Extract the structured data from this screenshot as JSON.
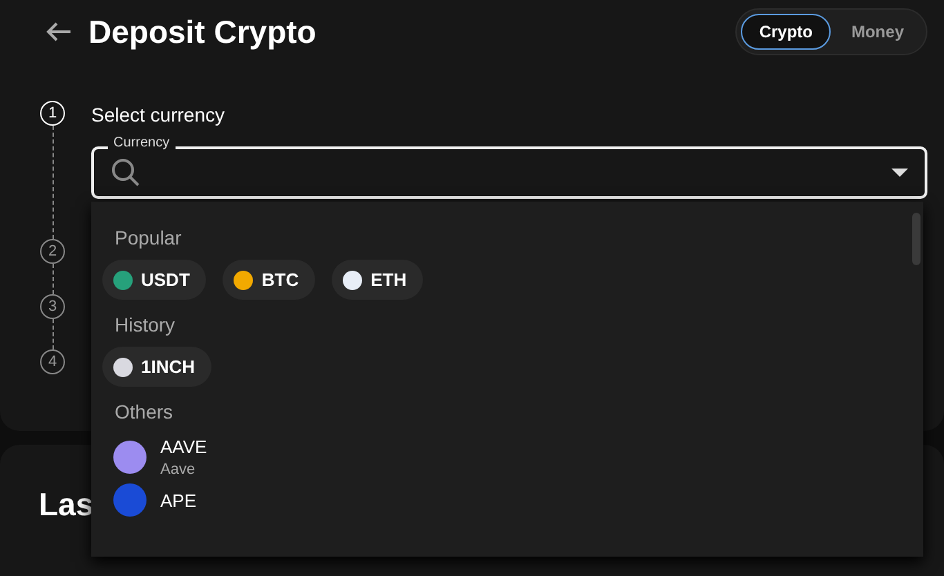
{
  "header": {
    "title": "Deposit Crypto",
    "toggle": [
      {
        "label": "Crypto",
        "selected": true
      },
      {
        "label": "Money",
        "selected": false
      }
    ]
  },
  "steps": [
    {
      "number": "1",
      "label": "Select currency",
      "active": true
    },
    {
      "number": "2",
      "active": false
    },
    {
      "number": "3",
      "active": false
    },
    {
      "number": "4",
      "active": false
    }
  ],
  "currency_field": {
    "label": "Currency"
  },
  "dropdown": {
    "sections": [
      {
        "heading": "Popular",
        "kind": "chips",
        "items": [
          {
            "symbol": "USDT",
            "color": "#26a17b"
          },
          {
            "symbol": "BTC",
            "color": "#f2a900"
          },
          {
            "symbol": "ETH",
            "color": "#e8eef7"
          }
        ]
      },
      {
        "heading": "History",
        "kind": "chips",
        "items": [
          {
            "symbol": "1INCH",
            "color": "#d9d9e0"
          }
        ]
      },
      {
        "heading": "Others",
        "kind": "list",
        "items": [
          {
            "symbol": "AAVE",
            "name": "Aave",
            "color": "#9c8cf0"
          },
          {
            "symbol": "APE",
            "color": "#1a4bd6"
          }
        ]
      }
    ]
  },
  "last_section": {
    "title": "Las"
  }
}
